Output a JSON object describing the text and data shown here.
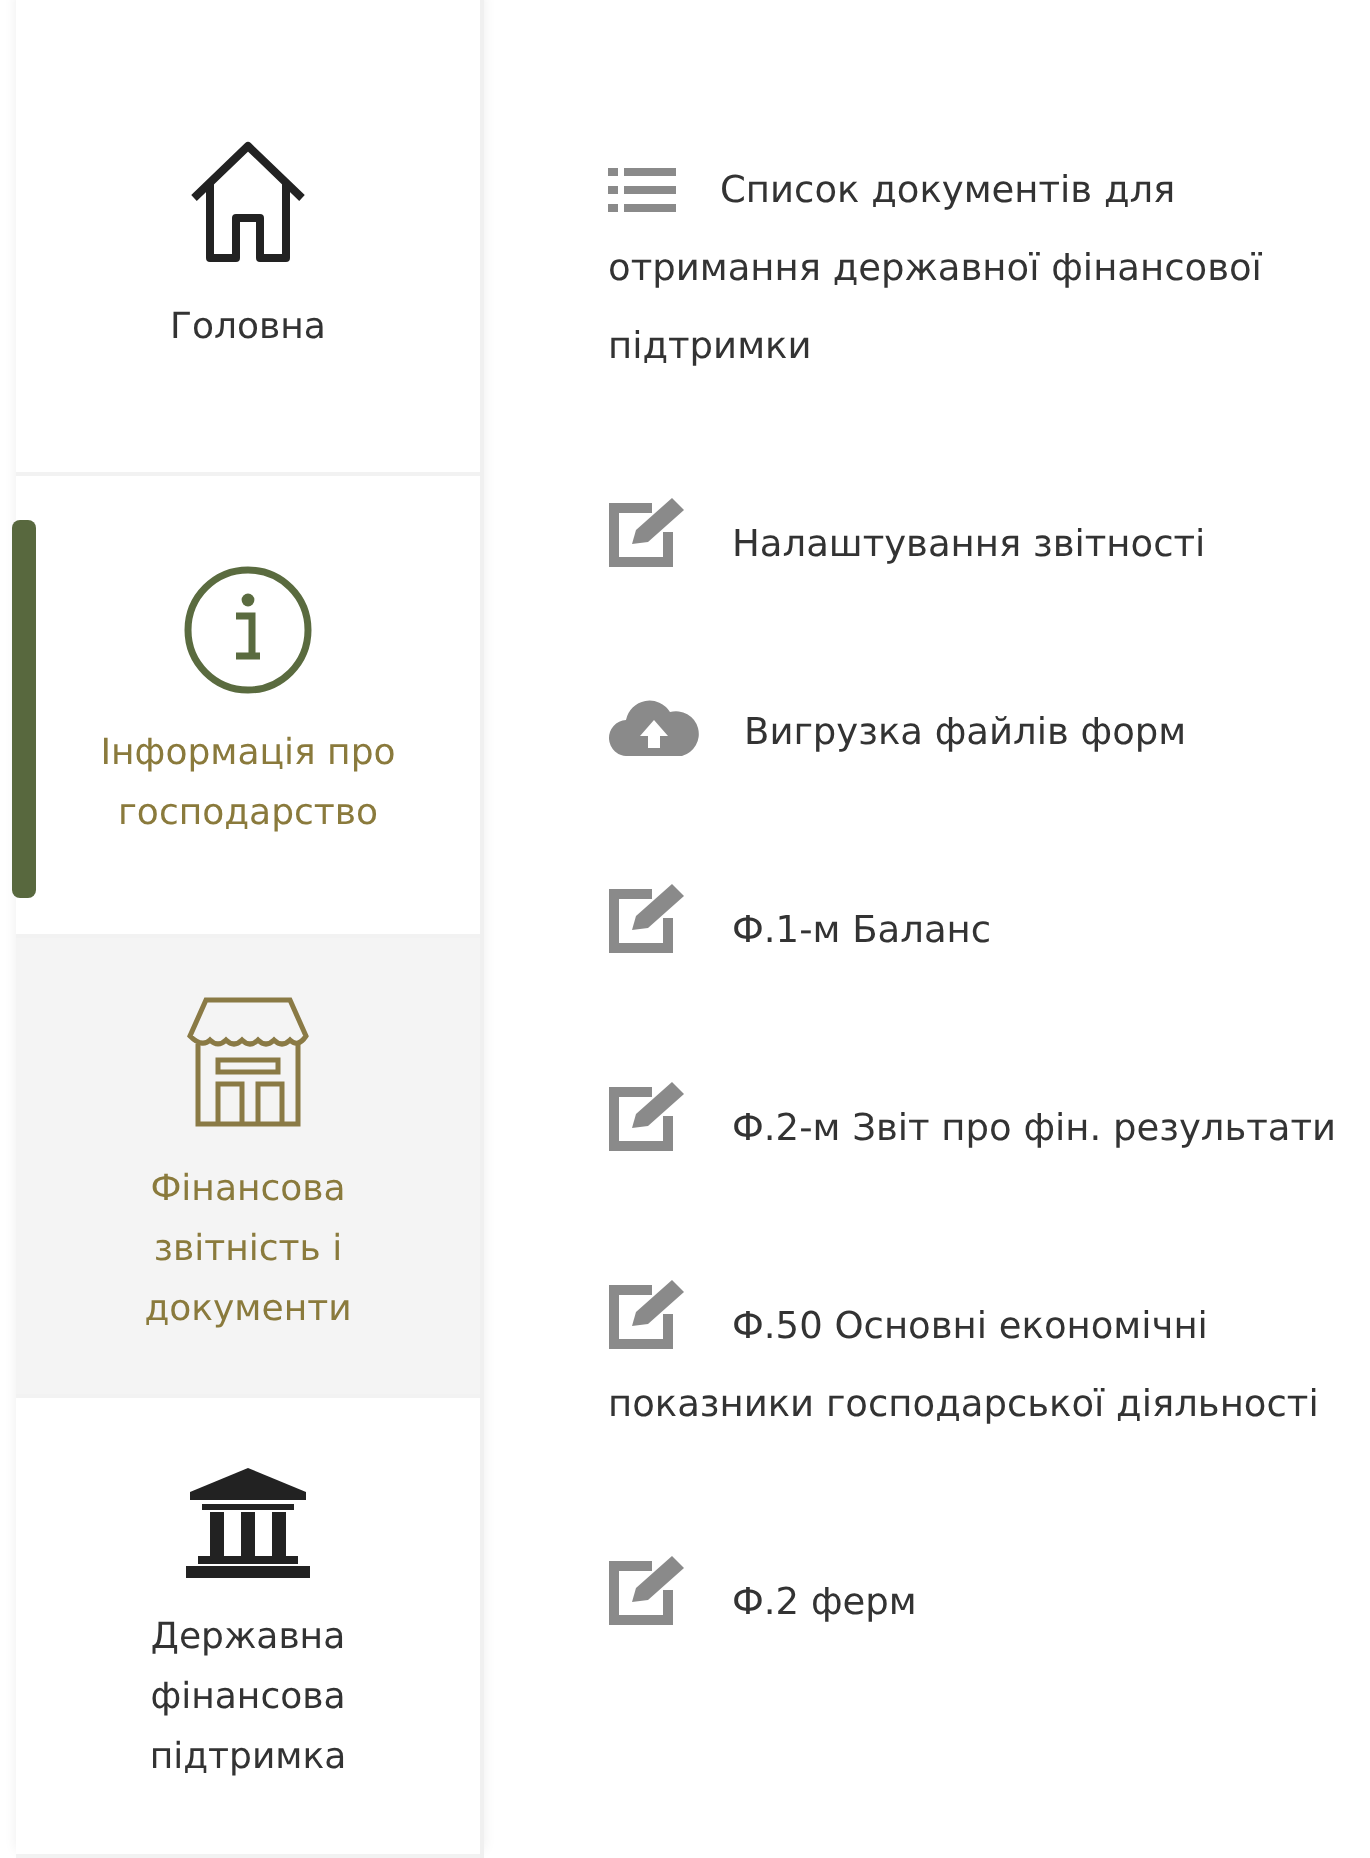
{
  "sidebar": {
    "items": [
      {
        "label": "Головна",
        "kind": "house",
        "selected": false,
        "hovered": false
      },
      {
        "label": "Інформація про господарство",
        "kind": "info",
        "selected": true,
        "hovered": false
      },
      {
        "label": "Фінансова звітність і документи",
        "kind": "store",
        "selected": false,
        "hovered": true
      },
      {
        "label": "Державна фінансова підтримка",
        "kind": "bank",
        "selected": false,
        "hovered": false
      }
    ]
  },
  "menu": {
    "items": [
      {
        "label": "Список документів для отримання державної фінансової підтримки",
        "kind": "list"
      },
      {
        "label": "Налаштування звітності",
        "kind": "edit"
      },
      {
        "label": "Вигрузка файлів форм",
        "kind": "cloud"
      },
      {
        "label": "Ф.1-м Баланс",
        "kind": "edit"
      },
      {
        "label": "Ф.2-м Звіт про фін. результати",
        "kind": "edit"
      },
      {
        "label": "Ф.50 Основні економічні показники господарської діяльності",
        "kind": "edit"
      },
      {
        "label": "Ф.2 ферм",
        "kind": "edit"
      }
    ]
  }
}
